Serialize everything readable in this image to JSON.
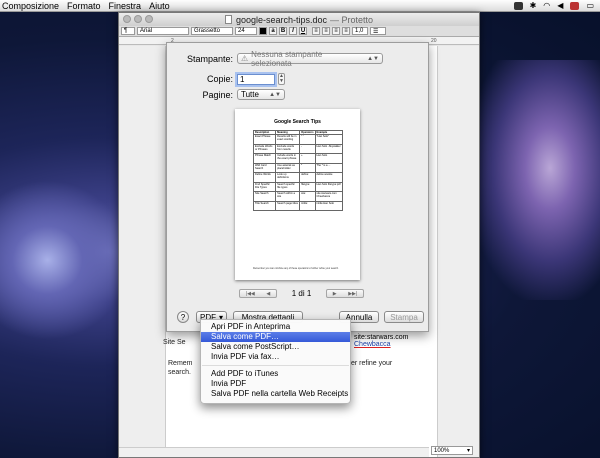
{
  "menubar": {
    "items": [
      "Composizione",
      "Formato",
      "Finestra",
      "Aiuto"
    ]
  },
  "window": {
    "title": "google-search-tips.doc",
    "title_suffix": "— Protetto",
    "toolbar": {
      "font": "Arial",
      "style": "Grassetto",
      "size": "24",
      "spacing": "1,0"
    },
    "ruler": {
      "left_num": "2",
      "right_num": "20"
    },
    "zoom": "100%"
  },
  "document": {
    "site_search_label": "Site Se",
    "remember_line1": "Remem",
    "remember_line2": "search.",
    "refine_text": "er refine your",
    "cell_site": "site:starwars.com",
    "cell_chew": "Chewbacca"
  },
  "print_dialog": {
    "printer_label": "Stampante:",
    "printer_value": "Nessuna stampante selezionata",
    "copies_label": "Copie:",
    "copies_value": "1",
    "pages_label": "Pagine:",
    "pages_value": "Tutte",
    "preview": {
      "title": "Google Search Tips",
      "headers": [
        "Description",
        "Meaning",
        "Operators",
        "Example"
      ],
      "rows": [
        [
          "Exact Phrase",
          "Results will be in exact wording",
          "\" \"",
          "\"Han Solo\""
        ],
        [
          "Exclude Words or Phrases",
          "Exclude words from results",
          "-",
          "Han Solo -Skywalker"
        ],
        [
          "Phrase Match",
          "Include words in the exact phrase",
          "+",
          "Han Solo"
        ],
        [
          "Wild Card Search",
          "Use asterisk as placeholder",
          "*",
          "The * is a ..."
        ],
        [
          "Define Words",
          "Look up definitions",
          "define:",
          "define:wookie"
        ],
        [
          "Find Specific File Types",
          "Search specific file types",
          "filetype:",
          "Han Solo filetype:pdf"
        ],
        [
          "Site Search",
          "Search within a site",
          "site:",
          "site:starwars.com Chewbacca"
        ],
        [
          "Title Search",
          "Search page titles",
          "intitle:",
          "intitle:Han Solo"
        ]
      ],
      "footer": "Remember you can combine any of these operators to further refine your search."
    },
    "pager_text": "1 di 1",
    "help_label": "?",
    "pdf_label": "PDF",
    "details_label": "Mostra dettagli",
    "cancel_label": "Annulla",
    "print_label": "Stampa"
  },
  "pdf_menu": {
    "items": [
      "Apri PDF in Anteprima",
      "Salva come PDF…",
      "Salva come PostScript…",
      "Invia PDF via fax…",
      "Add PDF to iTunes",
      "Invia PDF",
      "Salva PDF nella cartella Web Receipts"
    ],
    "selected_index": 1
  }
}
